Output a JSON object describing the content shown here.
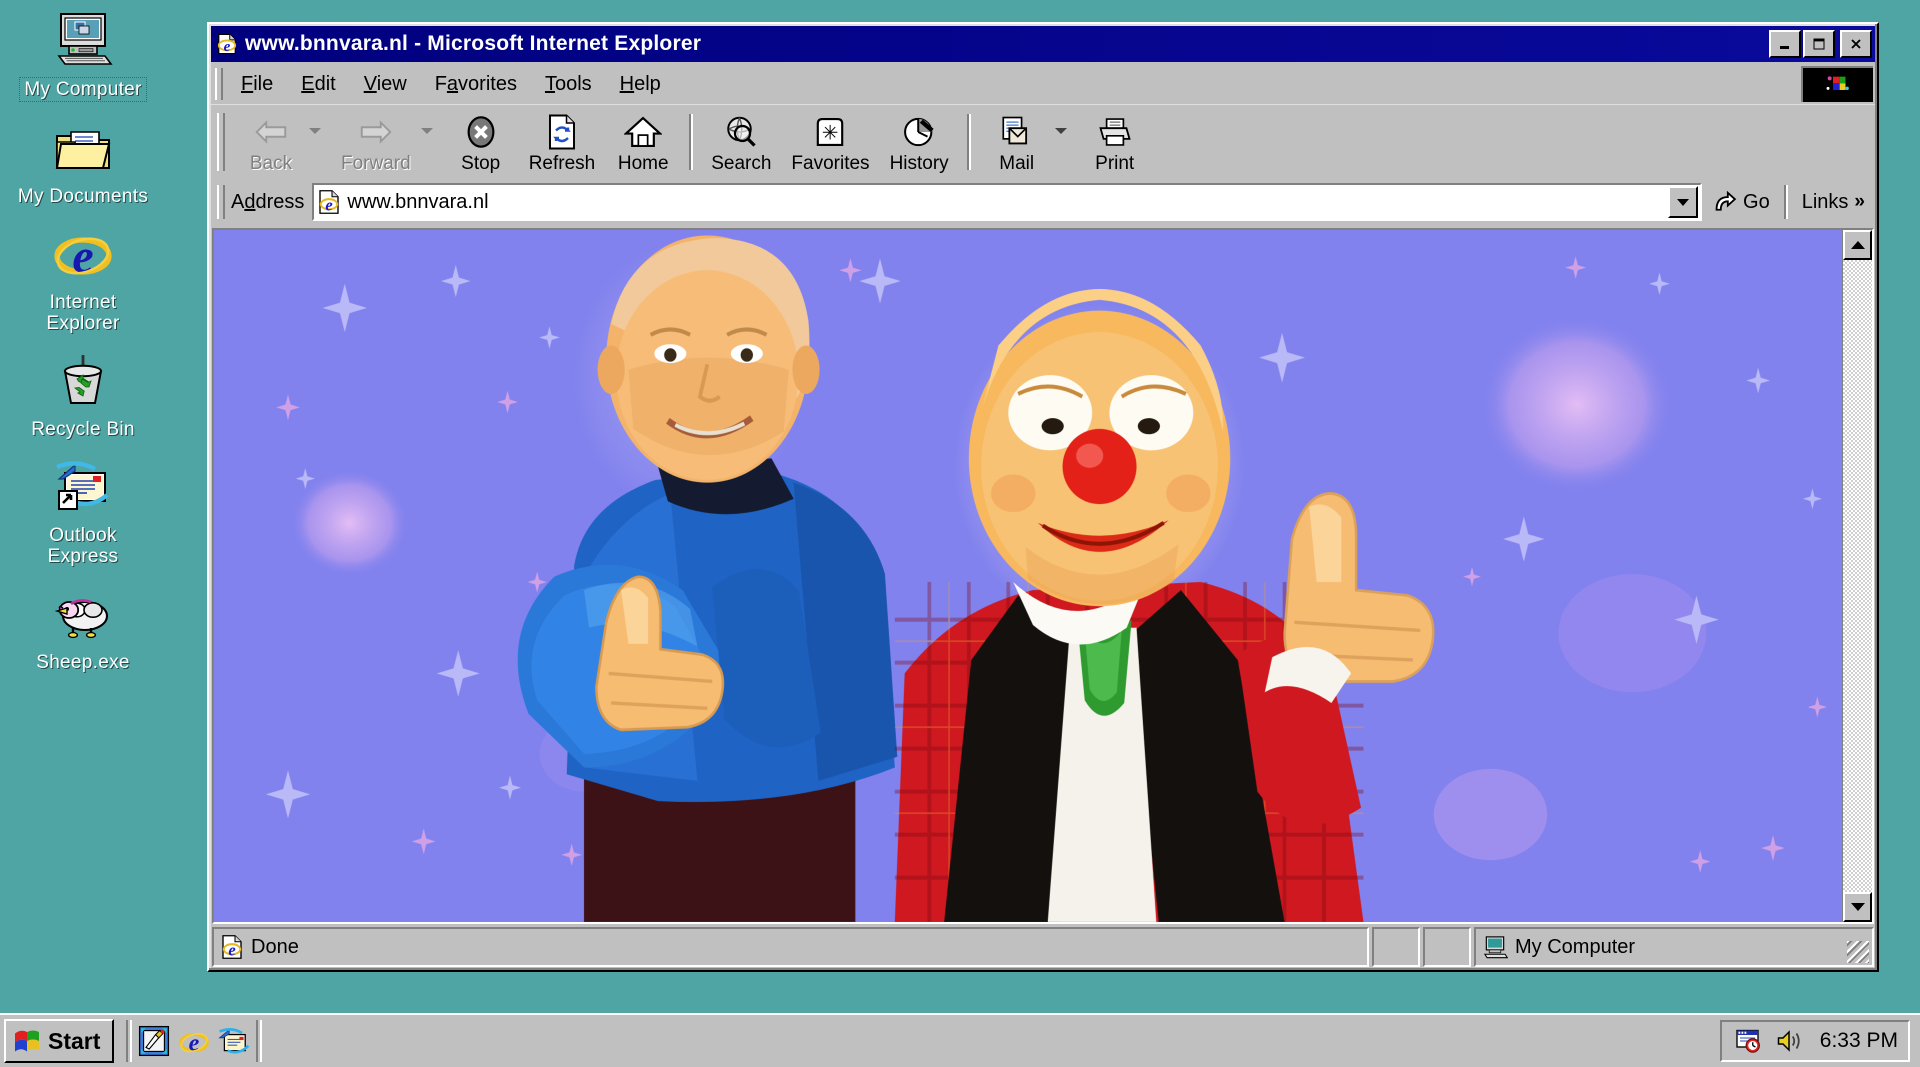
{
  "desktop": {
    "background_color": "#4fa5a3",
    "icons": [
      {
        "label": "My Computer",
        "icon": "my-computer-icon",
        "selected": true
      },
      {
        "label": "My Documents",
        "icon": "my-documents-icon",
        "selected": false
      },
      {
        "label": "Internet\nExplorer",
        "icon": "internet-explorer-icon",
        "selected": false
      },
      {
        "label": "Recycle Bin",
        "icon": "recycle-bin-icon",
        "selected": false
      },
      {
        "label": "Outlook\nExpress",
        "icon": "outlook-express-icon",
        "selected": false
      },
      {
        "label": "Sheep.exe",
        "icon": "sheep-icon",
        "selected": false
      }
    ]
  },
  "window": {
    "title": "www.bnnvara.nl - Microsoft Internet Explorer",
    "title_icon": "internet-explorer-document-icon",
    "titlebar_color": "#00007e",
    "controls": {
      "minimize": "_",
      "maximize": "□",
      "close": "✕"
    },
    "menu": [
      {
        "label": "File",
        "accel": "F"
      },
      {
        "label": "Edit",
        "accel": "E"
      },
      {
        "label": "View",
        "accel": "V"
      },
      {
        "label": "Favorites",
        "accel": "a"
      },
      {
        "label": "Tools",
        "accel": "T"
      },
      {
        "label": "Help",
        "accel": "H"
      }
    ],
    "brand_logo": "ie-animated-logo",
    "toolbar": [
      {
        "label": "Back",
        "icon": "back-arrow-icon",
        "disabled": true,
        "dropdown": true
      },
      {
        "label": "Forward",
        "icon": "forward-arrow-icon",
        "disabled": true,
        "dropdown": true
      },
      {
        "label": "Stop",
        "icon": "stop-x-icon",
        "disabled": false,
        "dropdown": false
      },
      {
        "label": "Refresh",
        "icon": "refresh-page-icon",
        "disabled": false,
        "dropdown": false
      },
      {
        "label": "Home",
        "icon": "home-house-icon",
        "disabled": false,
        "dropdown": false
      },
      {
        "label": "Search",
        "icon": "search-globe-icon",
        "disabled": false,
        "dropdown": false
      },
      {
        "label": "Favorites",
        "icon": "favorites-folder-star-icon",
        "disabled": false,
        "dropdown": false
      },
      {
        "label": "History",
        "icon": "history-clock-icon",
        "disabled": false,
        "dropdown": false
      },
      {
        "label": "Mail",
        "icon": "mail-envelope-icon",
        "disabled": false,
        "dropdown": true
      },
      {
        "label": "Print",
        "icon": "printer-icon",
        "disabled": false,
        "dropdown": false
      }
    ],
    "address": {
      "label": "Address",
      "accel": "d",
      "value": "www.bnnvara.nl",
      "placeholder": "",
      "favicon": "internet-explorer-document-icon",
      "go_label": "Go",
      "go_icon": "go-arrow-icon",
      "links_label": "Links",
      "links_chevron": "»"
    },
    "statusbar": {
      "message": "Done",
      "message_icon": "internet-explorer-document-icon",
      "zone_label": "My Computer",
      "zone_icon": "my-computer-small-icon"
    },
    "scrollbar": {
      "up_arrow": "scroll-up-arrow",
      "down_arrow": "scroll-down-arrow",
      "thumb_visible": false
    }
  },
  "page": {
    "background_color": "#8282ee",
    "description": "Photo of two men giving thumbs-up on a purple starry background",
    "sparkle_color_light": "#b9b9f5",
    "sparkle_color_pink": "#e2a8e0",
    "blob_color": "#c5a6e8"
  },
  "taskbar": {
    "start_label": "Start",
    "start_icon": "windows-flag-icon",
    "quick_launch": [
      {
        "icon": "show-desktop-icon",
        "name": "show-desktop"
      },
      {
        "icon": "internet-explorer-icon",
        "name": "launch-internet-explorer"
      },
      {
        "icon": "outlook-express-icon",
        "name": "launch-outlook-express"
      }
    ],
    "tray": [
      {
        "icon": "task-scheduler-icon",
        "name": "task-scheduler"
      },
      {
        "icon": "volume-speaker-icon",
        "name": "volume-control"
      }
    ],
    "clock": "6:33 PM"
  }
}
